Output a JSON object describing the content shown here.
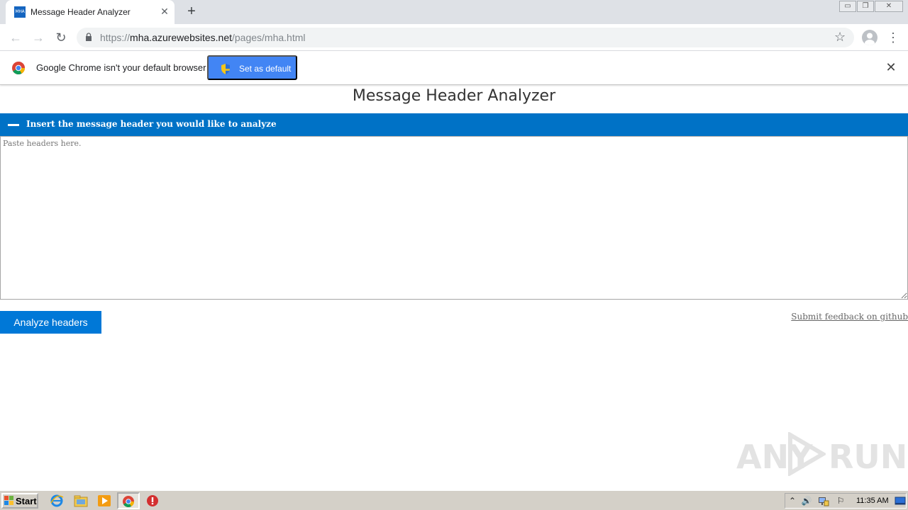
{
  "browser": {
    "tab": {
      "favicon_text": "MHA",
      "title": "Message Header Analyzer",
      "close_glyph": "✕"
    },
    "new_tab_glyph": "+",
    "window_controls": [
      "▭",
      "❐",
      "✕"
    ],
    "nav": {
      "back": "←",
      "forward": "→",
      "reload": "↻"
    },
    "omnibox": {
      "scheme": "https://",
      "host": "mha.azurewebsites.net",
      "path": "/pages/mha.html"
    },
    "star_glyph": "☆",
    "menu_glyph": "⋮"
  },
  "infobar": {
    "message": "Google Chrome isn't your default browser",
    "set_default_label": "Set as default",
    "close_glyph": "✕"
  },
  "page": {
    "title": "Message Header Analyzer",
    "section_label": "Insert the message header you would like to analyze",
    "headers_placeholder": "Paste headers here.",
    "headers_value": "",
    "analyze_label": "Analyze headers",
    "feedback_label": "Submit feedback on github"
  },
  "watermark": {
    "left": "ANY",
    "right": "RUN"
  },
  "taskbar": {
    "start_label": "Start",
    "clock": "11:35 AM",
    "tray_glyphs": {
      "expand": "⌃",
      "volume": "🔊",
      "flag": "⚐"
    }
  },
  "colors": {
    "section_bar": "#0072c6",
    "analyze_button": "#0078d7",
    "set_default_button": "#4285f4"
  }
}
